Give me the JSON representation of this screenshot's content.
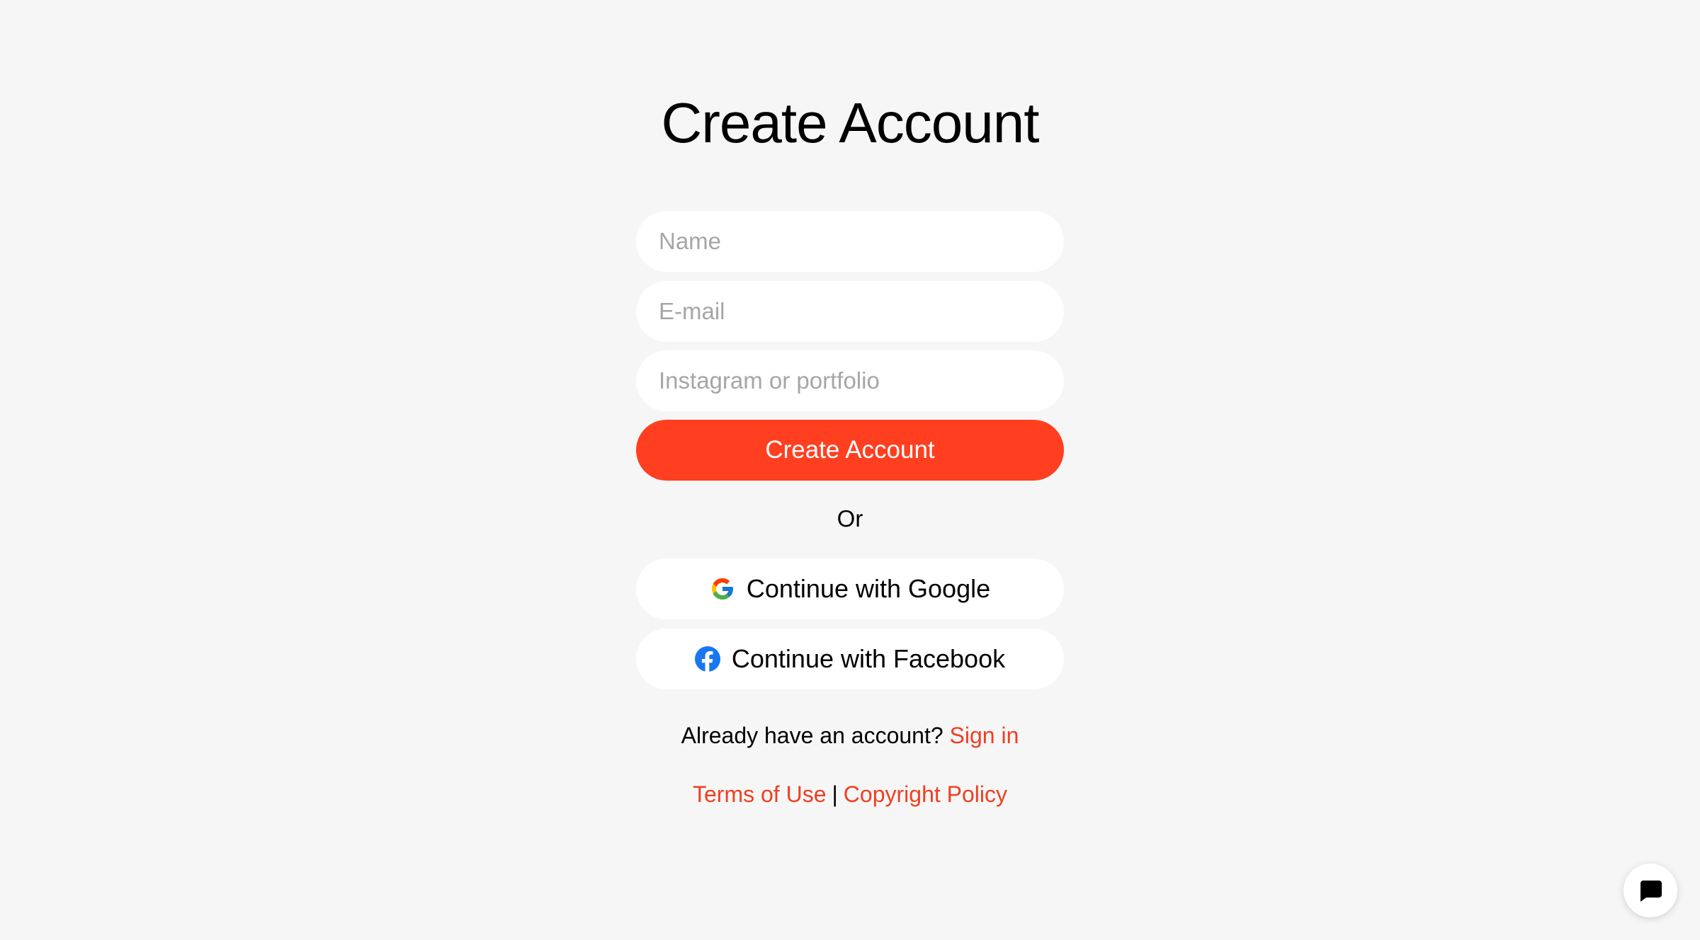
{
  "page": {
    "title": "Create Account"
  },
  "form": {
    "name_placeholder": "Name",
    "email_placeholder": "E-mail",
    "portfolio_placeholder": "Instagram or portfolio",
    "submit_label": "Create Account"
  },
  "divider": {
    "text": "Or"
  },
  "social": {
    "google_label": "Continue with Google",
    "google_icon": "google-icon",
    "facebook_label": "Continue with Facebook",
    "facebook_icon": "facebook-icon"
  },
  "signin": {
    "prompt": "Already have an account?",
    "link_label": "Sign in"
  },
  "footer": {
    "terms_label": "Terms of Use",
    "separator": "|",
    "copyright_label": "Copyright Policy"
  },
  "chat": {
    "icon": "chat-icon"
  },
  "colors": {
    "background": "#f6f6f6",
    "primary": "#ff3f20",
    "link": "#f03f20",
    "placeholder": "#a6a6a6",
    "facebook_blue": "#1877f2"
  }
}
